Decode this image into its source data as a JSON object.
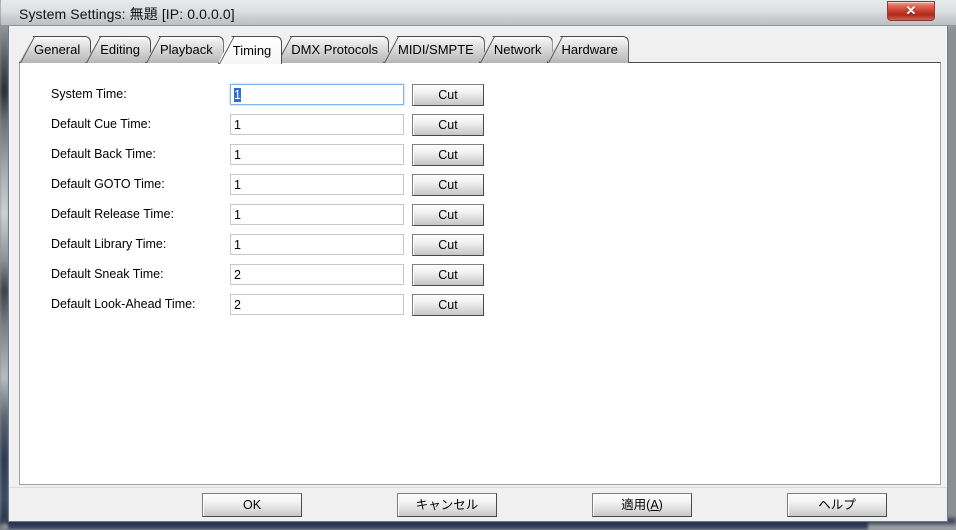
{
  "window": {
    "title": "System Settings: 無題  [IP: 0.0.0.0]",
    "close_label": "✕",
    "close_icon": "close-icon"
  },
  "tabs": [
    {
      "label": "General",
      "selected": false
    },
    {
      "label": "Editing",
      "selected": false
    },
    {
      "label": "Playback",
      "selected": false
    },
    {
      "label": "Timing",
      "selected": true
    },
    {
      "label": "DMX Protocols",
      "selected": false
    },
    {
      "label": "MIDI/SMPTE",
      "selected": false
    },
    {
      "label": "Network",
      "selected": false
    },
    {
      "label": "Hardware",
      "selected": false
    }
  ],
  "timing": {
    "cut_label": "Cut",
    "rows": [
      {
        "label": "System Time:",
        "value": "1",
        "focused": true
      },
      {
        "label": "Default Cue Time:",
        "value": "1",
        "focused": false
      },
      {
        "label": "Default Back Time:",
        "value": "1",
        "focused": false
      },
      {
        "label": "Default GOTO Time:",
        "value": "1",
        "focused": false
      },
      {
        "label": "Default Release Time:",
        "value": "1",
        "focused": false
      },
      {
        "label": "Default Library Time:",
        "value": "1",
        "focused": false
      },
      {
        "label": "Default Sneak Time:",
        "value": "2",
        "focused": false
      },
      {
        "label": "Default Look-Ahead Time:",
        "value": "2",
        "focused": false
      }
    ]
  },
  "footer": {
    "ok_label": "OK",
    "cancel_label": "キャンセル",
    "apply_label": "適用(A)",
    "apply_mnemonic": "A",
    "help_label": "ヘルプ"
  },
  "colors": {
    "titlebar_top": "#e9eaec",
    "titlebar_bottom": "#bcc0c3",
    "close_red": "#c43c2c",
    "focus_border": "#7eb4ea",
    "selection_blue": "#2a6fd6",
    "dialog_face": "#f0f0f0",
    "panel_white": "#ffffff"
  }
}
